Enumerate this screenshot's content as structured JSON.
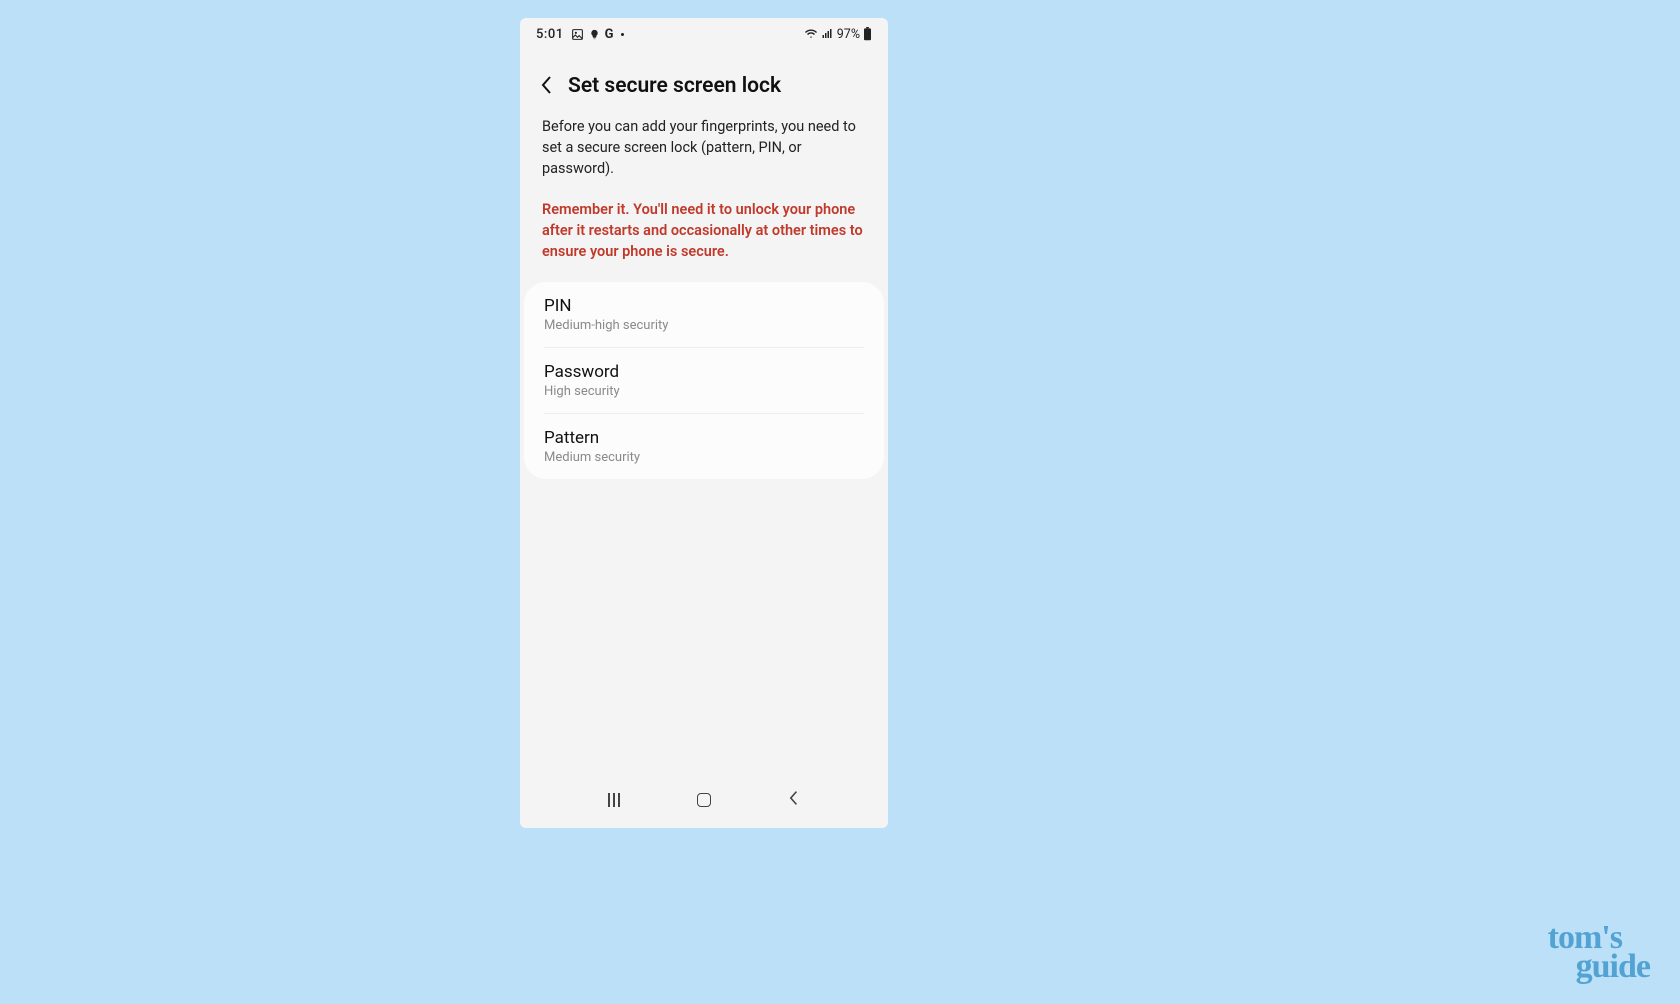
{
  "status": {
    "time": "5:01",
    "battery_pct": "97%",
    "icons_left": {
      "picture": "🖼",
      "bulb": "🔅",
      "g": "G"
    },
    "icons_right": {
      "wifi": "📶",
      "signal": "📶",
      "battery": "🔋"
    }
  },
  "header": {
    "back_glyph": "‹",
    "title": "Set secure screen lock"
  },
  "description": {
    "body": "Before you can add your fingerprints, you need to set a secure screen lock (pattern, PIN, or password).",
    "warning": "Remember it. You'll need it to unlock your phone after it restarts and occasionally at other times to ensure your phone is secure."
  },
  "options": [
    {
      "title": "PIN",
      "subtitle": "Medium-high security"
    },
    {
      "title": "Password",
      "subtitle": "High security"
    },
    {
      "title": "Pattern",
      "subtitle": "Medium security"
    }
  ],
  "nav": {
    "back_glyph": "‹"
  },
  "watermark": {
    "line1": "tom's",
    "line2": "guide"
  }
}
